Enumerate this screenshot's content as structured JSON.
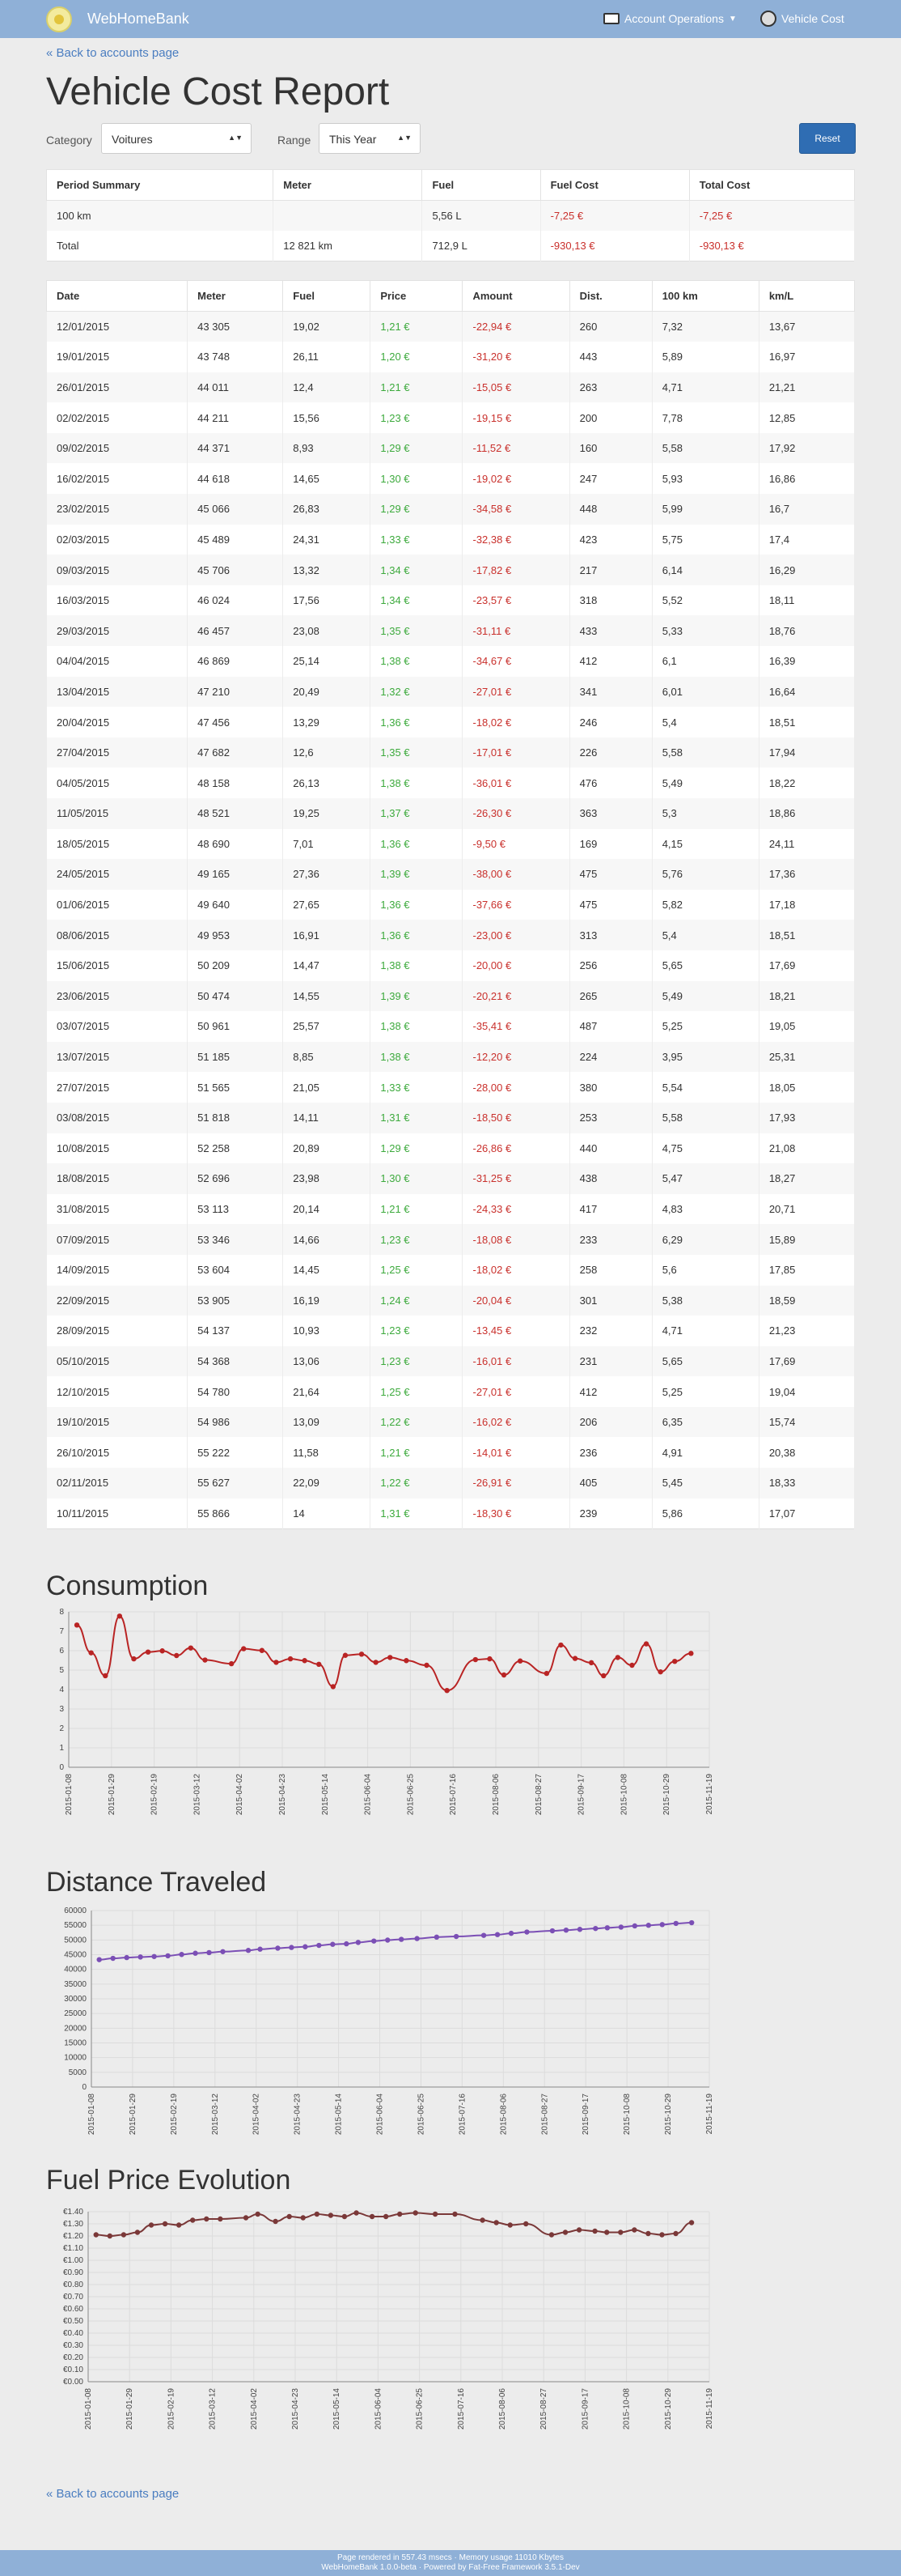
{
  "nav": {
    "brand": "WebHomeBank",
    "account_ops": "Account Operations",
    "vehicle_cost": "Vehicle Cost"
  },
  "back_link": "« Back to accounts page",
  "title": "Vehicle Cost Report",
  "filters": {
    "category_label": "Category",
    "category_value": "Voitures",
    "range_label": "Range",
    "range_value": "This Year",
    "reset": "Reset"
  },
  "summary": {
    "headers": [
      "Period Summary",
      "Meter",
      "Fuel",
      "Fuel Cost",
      "Total Cost"
    ],
    "rows": [
      [
        "100 km",
        "",
        "5,56 L",
        "-7,25 €",
        "-7,25 €"
      ],
      [
        "Total",
        "12 821 km",
        "712,9 L",
        "-930,13 €",
        "-930,13 €"
      ]
    ]
  },
  "detail": {
    "headers": [
      "Date",
      "Meter",
      "Fuel",
      "Price",
      "Amount",
      "Dist.",
      "100 km",
      "km/L"
    ],
    "rows": [
      [
        "12/01/2015",
        "43 305",
        "19,02",
        "1,21 €",
        "-22,94 €",
        "260",
        "7,32",
        "13,67"
      ],
      [
        "19/01/2015",
        "43 748",
        "26,11",
        "1,20 €",
        "-31,20 €",
        "443",
        "5,89",
        "16,97"
      ],
      [
        "26/01/2015",
        "44 011",
        "12,4",
        "1,21 €",
        "-15,05 €",
        "263",
        "4,71",
        "21,21"
      ],
      [
        "02/02/2015",
        "44 211",
        "15,56",
        "1,23 €",
        "-19,15 €",
        "200",
        "7,78",
        "12,85"
      ],
      [
        "09/02/2015",
        "44 371",
        "8,93",
        "1,29 €",
        "-11,52 €",
        "160",
        "5,58",
        "17,92"
      ],
      [
        "16/02/2015",
        "44 618",
        "14,65",
        "1,30 €",
        "-19,02 €",
        "247",
        "5,93",
        "16,86"
      ],
      [
        "23/02/2015",
        "45 066",
        "26,83",
        "1,29 €",
        "-34,58 €",
        "448",
        "5,99",
        "16,7"
      ],
      [
        "02/03/2015",
        "45 489",
        "24,31",
        "1,33 €",
        "-32,38 €",
        "423",
        "5,75",
        "17,4"
      ],
      [
        "09/03/2015",
        "45 706",
        "13,32",
        "1,34 €",
        "-17,82 €",
        "217",
        "6,14",
        "16,29"
      ],
      [
        "16/03/2015",
        "46 024",
        "17,56",
        "1,34 €",
        "-23,57 €",
        "318",
        "5,52",
        "18,11"
      ],
      [
        "29/03/2015",
        "46 457",
        "23,08",
        "1,35 €",
        "-31,11 €",
        "433",
        "5,33",
        "18,76"
      ],
      [
        "04/04/2015",
        "46 869",
        "25,14",
        "1,38 €",
        "-34,67 €",
        "412",
        "6,1",
        "16,39"
      ],
      [
        "13/04/2015",
        "47 210",
        "20,49",
        "1,32 €",
        "-27,01 €",
        "341",
        "6,01",
        "16,64"
      ],
      [
        "20/04/2015",
        "47 456",
        "13,29",
        "1,36 €",
        "-18,02 €",
        "246",
        "5,4",
        "18,51"
      ],
      [
        "27/04/2015",
        "47 682",
        "12,6",
        "1,35 €",
        "-17,01 €",
        "226",
        "5,58",
        "17,94"
      ],
      [
        "04/05/2015",
        "48 158",
        "26,13",
        "1,38 €",
        "-36,01 €",
        "476",
        "5,49",
        "18,22"
      ],
      [
        "11/05/2015",
        "48 521",
        "19,25",
        "1,37 €",
        "-26,30 €",
        "363",
        "5,3",
        "18,86"
      ],
      [
        "18/05/2015",
        "48 690",
        "7,01",
        "1,36 €",
        "-9,50 €",
        "169",
        "4,15",
        "24,11"
      ],
      [
        "24/05/2015",
        "49 165",
        "27,36",
        "1,39 €",
        "-38,00 €",
        "475",
        "5,76",
        "17,36"
      ],
      [
        "01/06/2015",
        "49 640",
        "27,65",
        "1,36 €",
        "-37,66 €",
        "475",
        "5,82",
        "17,18"
      ],
      [
        "08/06/2015",
        "49 953",
        "16,91",
        "1,36 €",
        "-23,00 €",
        "313",
        "5,4",
        "18,51"
      ],
      [
        "15/06/2015",
        "50 209",
        "14,47",
        "1,38 €",
        "-20,00 €",
        "256",
        "5,65",
        "17,69"
      ],
      [
        "23/06/2015",
        "50 474",
        "14,55",
        "1,39 €",
        "-20,21 €",
        "265",
        "5,49",
        "18,21"
      ],
      [
        "03/07/2015",
        "50 961",
        "25,57",
        "1,38 €",
        "-35,41 €",
        "487",
        "5,25",
        "19,05"
      ],
      [
        "13/07/2015",
        "51 185",
        "8,85",
        "1,38 €",
        "-12,20 €",
        "224",
        "3,95",
        "25,31"
      ],
      [
        "27/07/2015",
        "51 565",
        "21,05",
        "1,33 €",
        "-28,00 €",
        "380",
        "5,54",
        "18,05"
      ],
      [
        "03/08/2015",
        "51 818",
        "14,11",
        "1,31 €",
        "-18,50 €",
        "253",
        "5,58",
        "17,93"
      ],
      [
        "10/08/2015",
        "52 258",
        "20,89",
        "1,29 €",
        "-26,86 €",
        "440",
        "4,75",
        "21,08"
      ],
      [
        "18/08/2015",
        "52 696",
        "23,98",
        "1,30 €",
        "-31,25 €",
        "438",
        "5,47",
        "18,27"
      ],
      [
        "31/08/2015",
        "53 113",
        "20,14",
        "1,21 €",
        "-24,33 €",
        "417",
        "4,83",
        "20,71"
      ],
      [
        "07/09/2015",
        "53 346",
        "14,66",
        "1,23 €",
        "-18,08 €",
        "233",
        "6,29",
        "15,89"
      ],
      [
        "14/09/2015",
        "53 604",
        "14,45",
        "1,25 €",
        "-18,02 €",
        "258",
        "5,6",
        "17,85"
      ],
      [
        "22/09/2015",
        "53 905",
        "16,19",
        "1,24 €",
        "-20,04 €",
        "301",
        "5,38",
        "18,59"
      ],
      [
        "28/09/2015",
        "54 137",
        "10,93",
        "1,23 €",
        "-13,45 €",
        "232",
        "4,71",
        "21,23"
      ],
      [
        "05/10/2015",
        "54 368",
        "13,06",
        "1,23 €",
        "-16,01 €",
        "231",
        "5,65",
        "17,69"
      ],
      [
        "12/10/2015",
        "54 780",
        "21,64",
        "1,25 €",
        "-27,01 €",
        "412",
        "5,25",
        "19,04"
      ],
      [
        "19/10/2015",
        "54 986",
        "13,09",
        "1,22 €",
        "-16,02 €",
        "206",
        "6,35",
        "15,74"
      ],
      [
        "26/10/2015",
        "55 222",
        "11,58",
        "1,21 €",
        "-14,01 €",
        "236",
        "4,91",
        "20,38"
      ],
      [
        "02/11/2015",
        "55 627",
        "22,09",
        "1,22 €",
        "-26,91 €",
        "405",
        "5,45",
        "18,33"
      ],
      [
        "10/11/2015",
        "55 866",
        "14",
        "1,31 €",
        "-18,30 €",
        "239",
        "5,86",
        "17,07"
      ]
    ]
  },
  "charts_titles": {
    "consumption": "Consumption",
    "distance": "Distance Traveled",
    "price": "Fuel Price Evolution"
  },
  "chart_data": [
    {
      "type": "line",
      "title": "Consumption",
      "color": "#b92424",
      "x": [
        "2015-01-12",
        "2015-01-19",
        "2015-01-26",
        "2015-02-02",
        "2015-02-09",
        "2015-02-16",
        "2015-02-23",
        "2015-03-02",
        "2015-03-09",
        "2015-03-16",
        "2015-03-29",
        "2015-04-04",
        "2015-04-13",
        "2015-04-20",
        "2015-04-27",
        "2015-05-04",
        "2015-05-11",
        "2015-05-18",
        "2015-05-24",
        "2015-06-01",
        "2015-06-08",
        "2015-06-15",
        "2015-06-23",
        "2015-07-03",
        "2015-07-13",
        "2015-07-27",
        "2015-08-03",
        "2015-08-10",
        "2015-08-18",
        "2015-08-31",
        "2015-09-07",
        "2015-09-14",
        "2015-09-22",
        "2015-09-28",
        "2015-10-05",
        "2015-10-12",
        "2015-10-19",
        "2015-10-26",
        "2015-11-02",
        "2015-11-10"
      ],
      "values": [
        7.32,
        5.89,
        4.71,
        7.78,
        5.58,
        5.93,
        5.99,
        5.75,
        6.14,
        5.52,
        5.33,
        6.1,
        6.01,
        5.4,
        5.58,
        5.49,
        5.3,
        4.15,
        5.76,
        5.82,
        5.4,
        5.65,
        5.49,
        5.25,
        3.95,
        5.54,
        5.58,
        4.75,
        5.47,
        4.83,
        6.29,
        5.6,
        5.38,
        4.71,
        5.65,
        5.25,
        6.35,
        4.91,
        5.45,
        5.86
      ],
      "ylim": [
        0,
        8
      ],
      "yticks": [
        "0",
        "1",
        "2",
        "3",
        "4",
        "5",
        "6",
        "7",
        "8"
      ],
      "xticks": [
        "2015-01-08",
        "2015-01-29",
        "2015-02-19",
        "2015-03-12",
        "2015-04-02",
        "2015-04-23",
        "2015-05-14",
        "2015-06-04",
        "2015-06-25",
        "2015-07-16",
        "2015-08-06",
        "2015-08-27",
        "2015-09-17",
        "2015-10-08",
        "2015-10-29",
        "2015-11-19"
      ]
    },
    {
      "type": "line",
      "title": "Distance Traveled",
      "color": "#7b4fb5",
      "x": [
        "2015-01-12",
        "2015-01-19",
        "2015-01-26",
        "2015-02-02",
        "2015-02-09",
        "2015-02-16",
        "2015-02-23",
        "2015-03-02",
        "2015-03-09",
        "2015-03-16",
        "2015-03-29",
        "2015-04-04",
        "2015-04-13",
        "2015-04-20",
        "2015-04-27",
        "2015-05-04",
        "2015-05-11",
        "2015-05-18",
        "2015-05-24",
        "2015-06-01",
        "2015-06-08",
        "2015-06-15",
        "2015-06-23",
        "2015-07-03",
        "2015-07-13",
        "2015-07-27",
        "2015-08-03",
        "2015-08-10",
        "2015-08-18",
        "2015-08-31",
        "2015-09-07",
        "2015-09-14",
        "2015-09-22",
        "2015-09-28",
        "2015-10-05",
        "2015-10-12",
        "2015-10-19",
        "2015-10-26",
        "2015-11-02",
        "2015-11-10"
      ],
      "values": [
        43305,
        43748,
        44011,
        44211,
        44371,
        44618,
        45066,
        45489,
        45706,
        46024,
        46457,
        46869,
        47210,
        47456,
        47682,
        48158,
        48521,
        48690,
        49165,
        49640,
        49953,
        50209,
        50474,
        50961,
        51185,
        51565,
        51818,
        52258,
        52696,
        53113,
        53346,
        53604,
        53905,
        54137,
        54368,
        54780,
        54986,
        55222,
        55627,
        55866
      ],
      "ylim": [
        0,
        60000
      ],
      "yticks": [
        "0",
        "5000",
        "10000",
        "15000",
        "20000",
        "25000",
        "30000",
        "35000",
        "40000",
        "45000",
        "50000",
        "55000",
        "60000"
      ],
      "xticks": [
        "2015-01-08",
        "2015-01-29",
        "2015-02-19",
        "2015-03-12",
        "2015-04-02",
        "2015-04-23",
        "2015-05-14",
        "2015-06-04",
        "2015-06-25",
        "2015-07-16",
        "2015-08-06",
        "2015-08-27",
        "2015-09-17",
        "2015-10-08",
        "2015-10-29",
        "2015-11-19"
      ]
    },
    {
      "type": "line",
      "title": "Fuel Price Evolution",
      "color": "#7a3838",
      "x": [
        "2015-01-12",
        "2015-01-19",
        "2015-01-26",
        "2015-02-02",
        "2015-02-09",
        "2015-02-16",
        "2015-02-23",
        "2015-03-02",
        "2015-03-09",
        "2015-03-16",
        "2015-03-29",
        "2015-04-04",
        "2015-04-13",
        "2015-04-20",
        "2015-04-27",
        "2015-05-04",
        "2015-05-11",
        "2015-05-18",
        "2015-05-24",
        "2015-06-01",
        "2015-06-08",
        "2015-06-15",
        "2015-06-23",
        "2015-07-03",
        "2015-07-13",
        "2015-07-27",
        "2015-08-03",
        "2015-08-10",
        "2015-08-18",
        "2015-08-31",
        "2015-09-07",
        "2015-09-14",
        "2015-09-22",
        "2015-09-28",
        "2015-10-05",
        "2015-10-12",
        "2015-10-19",
        "2015-10-26",
        "2015-11-02",
        "2015-11-10"
      ],
      "values": [
        1.21,
        1.2,
        1.21,
        1.23,
        1.29,
        1.3,
        1.29,
        1.33,
        1.34,
        1.34,
        1.35,
        1.38,
        1.32,
        1.36,
        1.35,
        1.38,
        1.37,
        1.36,
        1.39,
        1.36,
        1.36,
        1.38,
        1.39,
        1.38,
        1.38,
        1.33,
        1.31,
        1.29,
        1.3,
        1.21,
        1.23,
        1.25,
        1.24,
        1.23,
        1.23,
        1.25,
        1.22,
        1.21,
        1.22,
        1.31
      ],
      "ylim": [
        0,
        1.4
      ],
      "yticks": [
        "€0.00",
        "€0.10",
        "€0.20",
        "€0.30",
        "€0.40",
        "€0.50",
        "€0.60",
        "€0.70",
        "€0.80",
        "€0.90",
        "€1.00",
        "€1.10",
        "€1.20",
        "€1.30",
        "€1.40"
      ],
      "xticks": [
        "2015-01-08",
        "2015-01-29",
        "2015-02-19",
        "2015-03-12",
        "2015-04-02",
        "2015-04-23",
        "2015-05-14",
        "2015-06-04",
        "2015-06-25",
        "2015-07-16",
        "2015-08-06",
        "2015-08-27",
        "2015-09-17",
        "2015-10-08",
        "2015-10-29",
        "2015-11-19"
      ]
    }
  ],
  "footer": {
    "line1": "Page rendered in 557.43 msecs · Memory usage 11010 Kbytes",
    "line2": "WebHomeBank 1.0.0-beta · Powered by Fat-Free Framework 3.5.1-Dev"
  }
}
